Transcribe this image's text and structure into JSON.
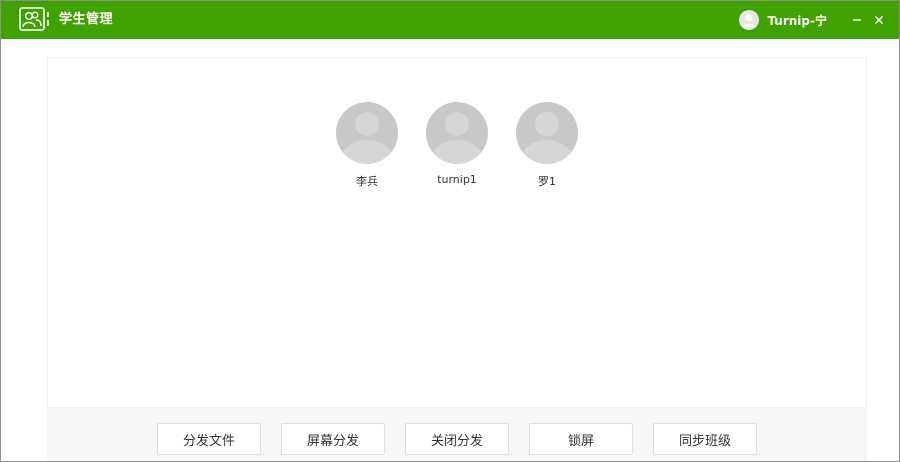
{
  "app": {
    "title": "学生管理",
    "logo_icon": "students-icon",
    "brand_color": "#3ea300"
  },
  "user": {
    "name": "Turnip-宁",
    "avatar_icon": "user-avatar-icon"
  },
  "window_controls": {
    "minimize_icon": "minimize-icon",
    "close_icon": "close-icon"
  },
  "students": [
    {
      "name": "李兵",
      "avatar_icon": "default-avatar-icon"
    },
    {
      "name": "turnip1",
      "avatar_icon": "default-avatar-icon"
    },
    {
      "name": "罗1",
      "avatar_icon": "default-avatar-icon"
    }
  ],
  "actions": [
    {
      "label": "分发文件"
    },
    {
      "label": "屏幕分发"
    },
    {
      "label": "关闭分发"
    },
    {
      "label": "锁屏"
    },
    {
      "label": "同步班级"
    }
  ]
}
